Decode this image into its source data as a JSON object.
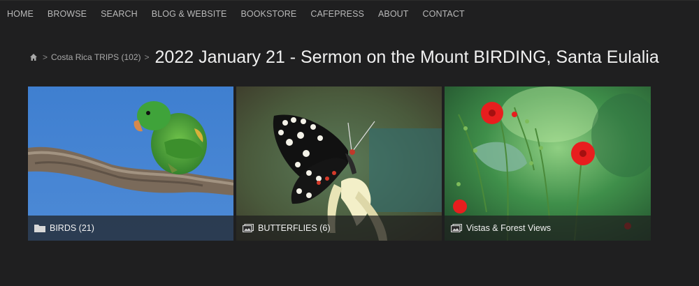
{
  "nav": {
    "items": [
      "HOME",
      "BROWSE",
      "SEARCH",
      "BLOG & WEBSITE",
      "BOOKSTORE",
      "CAFEPRESS",
      "ABOUT",
      "CONTACT"
    ]
  },
  "breadcrumb": {
    "home_icon": "home-icon",
    "parent": "Costa Rica TRIPS (102)",
    "separator": ">"
  },
  "page": {
    "title": "2022 January 21 - Sermon on the Mount BIRDING, Santa Eulalia"
  },
  "gallery": {
    "tiles": [
      {
        "label": "BIRDS (21)",
        "icon": "folder-icon",
        "photo": "green parakeet on branch"
      },
      {
        "label": "BUTTERFLIES (6)",
        "icon": "gallery-icon",
        "photo": "black and white butterfly on flower"
      },
      {
        "label": "Vistas & Forest Views",
        "icon": "gallery-icon",
        "photo": "red wildflowers"
      }
    ]
  },
  "colors": {
    "background": "#1f1f20",
    "nav_text": "#b9b9b9",
    "title_text": "#f0f0f0"
  }
}
